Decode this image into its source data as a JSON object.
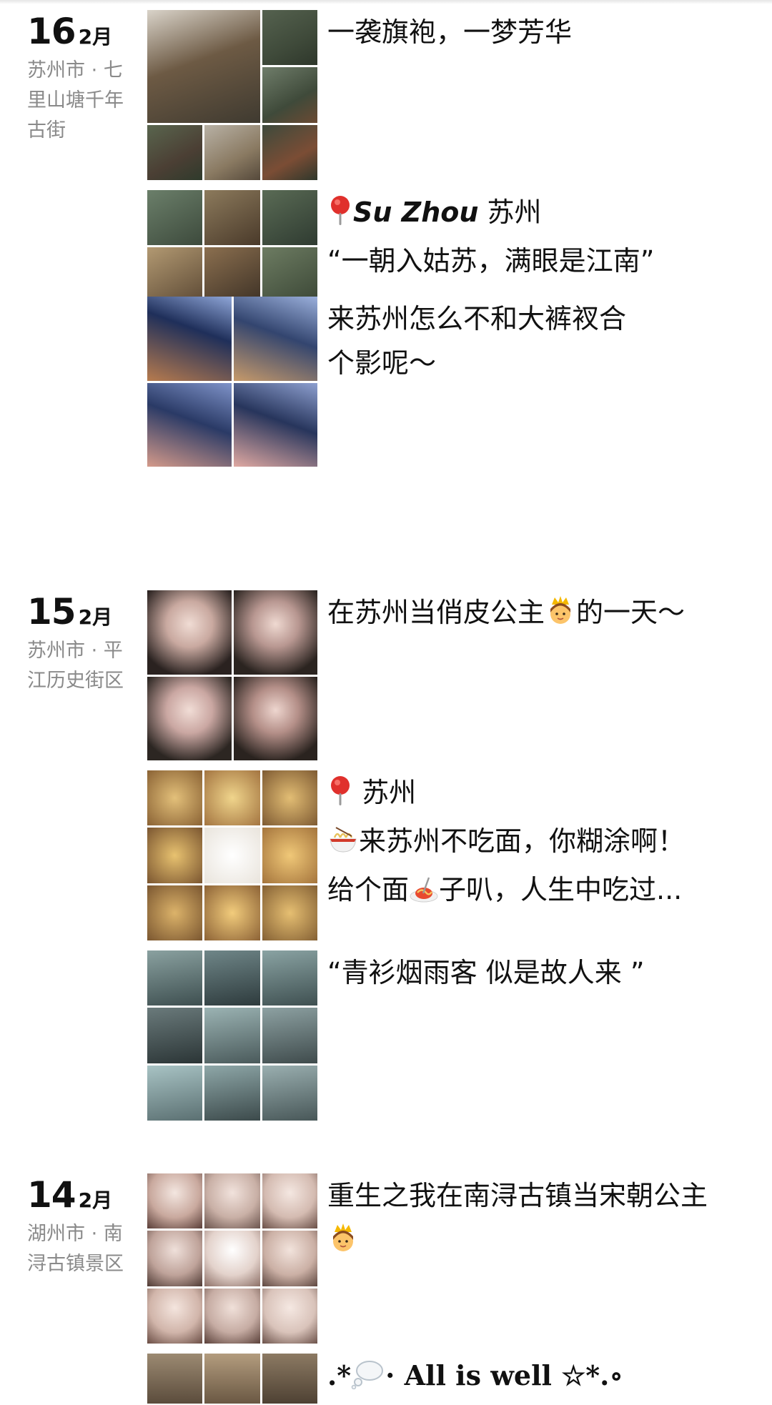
{
  "days": [
    {
      "day": "16",
      "month": "2月",
      "location": "苏州市 · 七里山塘千年古街",
      "posts": [
        {
          "caption": [
            "一袭旗袍，一梦芳华"
          ],
          "thumb_colors": [
            "#8a7a62",
            "#3f4a3a",
            "#6d5a44",
            "#d9d3c9",
            "#4b3f34"
          ]
        },
        {
          "pin_icon": "location-pin-icon",
          "caption_italic": "Su Zhou",
          "caption_tail": " 苏州",
          "caption": [
            "“一朝入姑苏，满眼是江南”"
          ],
          "thumb_colors": [
            "#3d4a3c",
            "#6c5b45",
            "#2f3b31",
            "#8a7654",
            "#49503f",
            "#5d4a35",
            "#3b4736",
            "#6e6354",
            "#44503c"
          ]
        },
        {
          "caption": [
            "来苏州怎么不和大裤衩合个影呢～"
          ],
          "thumb_colors": [
            "#1f2f5a",
            "#33456f",
            "#2a3a66",
            "#27355c"
          ]
        }
      ]
    },
    {
      "day": "15",
      "month": "2月",
      "location": "苏州市 · 平江历史街区",
      "posts": [
        {
          "caption_before_emoji": "在苏州当俏皮公主",
          "emoji_icon": "princess-emoji-icon",
          "caption_after_emoji": "的一天～",
          "thumb_colors": [
            "#c9a9a0",
            "#b89791",
            "#caa7a2",
            "#b48f88"
          ]
        },
        {
          "pin_icon": "location-pin-icon",
          "caption_tail": " 苏州",
          "noodle_icon": "noodle-bowl-icon",
          "line2": "来苏州不吃面，你糊涂啊！",
          "line3_a": " 给个面",
          "spaghetti_icon": "spaghetti-icon",
          "line3_b": "子叭，人生中吃过...",
          "thumb_colors": [
            "#c89a55",
            "#d6ab62",
            "#c2924e",
            "#b88a46",
            "#e9e4dc",
            "#c99a52",
            "#bf914d",
            "#d0a25b",
            "#c49452"
          ]
        },
        {
          "caption": [
            "“青衫烟雨客 似是故人来 ”"
          ],
          "thumb_colors": [
            "#566a6a",
            "#3d4f52",
            "#4e6060",
            "#3f4b4c",
            "#55696a",
            "#4a5a5b",
            "#6f8b8c",
            "#5b7072",
            "#485758"
          ]
        }
      ]
    },
    {
      "day": "14",
      "month": "2月",
      "location": "湖州市 · 南浔古镇景区",
      "posts": [
        {
          "caption_before_emoji": "重生之我在南浔古镇当宋朝公主",
          "emoji_icon": "princess-emoji-icon",
          "thumb_colors": [
            "#d8c1b9",
            "#c9b0a6",
            "#d4bbb1",
            "#bfa39a",
            "#e3d2cb",
            "#cbb0a5",
            "#d1b5aa",
            "#c6aca3",
            "#d9c3ba"
          ]
        },
        {
          "caption_a": ".*",
          "bubble_icon": "thought-bubble-icon",
          "caption_b": "· All is well ☆*.∘",
          "thumb_colors": [
            "#7a6a55",
            "#958066",
            "#6b5c4a"
          ]
        }
      ]
    }
  ]
}
